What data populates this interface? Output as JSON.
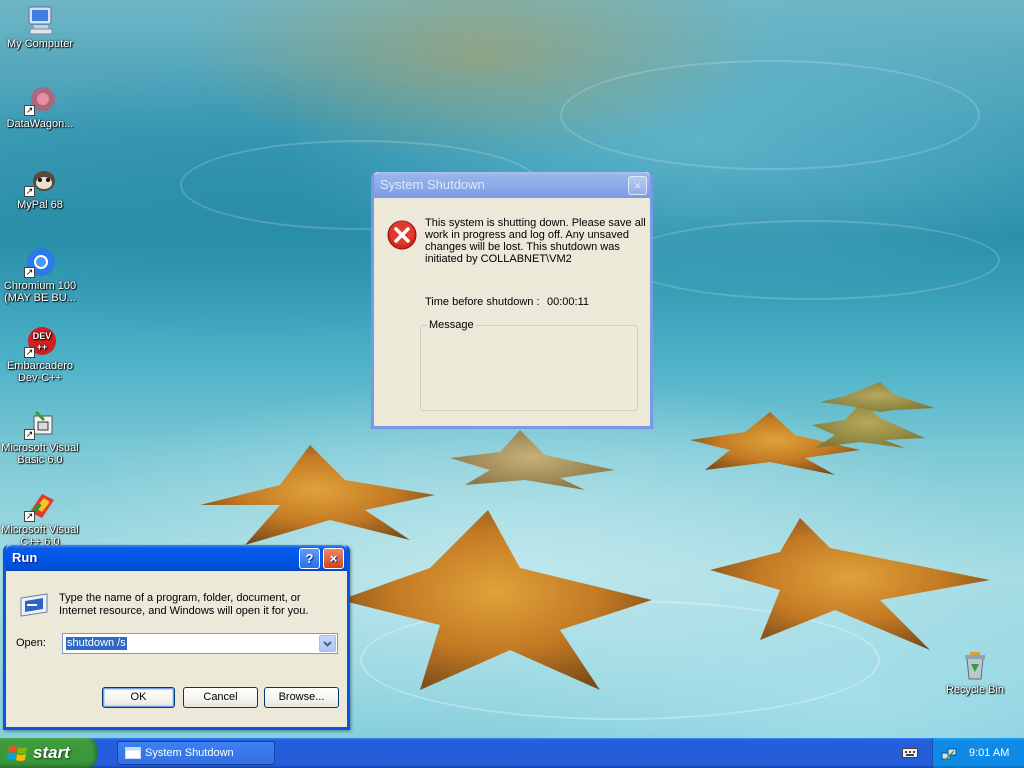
{
  "desktop_icons": [
    {
      "label": "My Computer",
      "icon": "my-computer-icon"
    },
    {
      "label": "DataWagon...",
      "icon": "datawagon-icon"
    },
    {
      "label": "MyPal 68",
      "icon": "mypal-icon"
    },
    {
      "label": "Chromium 100 (MAY BE BU...",
      "icon": "chromium-icon"
    },
    {
      "label": "Embarcadero Dev-C++",
      "icon": "devcpp-icon",
      "badge": "DEV",
      "badge2": "++"
    },
    {
      "label": "Microsoft Visual Basic 6.0",
      "icon": "vb6-icon"
    },
    {
      "label": "Microsoft Visual C++ 6.0",
      "icon": "vc6-icon"
    },
    {
      "label": "Recycle Bin",
      "icon": "recycle-bin-icon"
    }
  ],
  "shutdown_dialog": {
    "title": "System Shutdown",
    "close_glyph": "×",
    "message": "This system is shutting down. Please save all work in progress and log off. Any unsaved changes will be lost. This shutdown was initiated by COLLABNET\\VM2",
    "time_label": "Time before shutdown :",
    "time_value": "00:00:11",
    "message_group_label": "Message",
    "message_text": ""
  },
  "run_dialog": {
    "title": "Run",
    "help_glyph": "?",
    "close_glyph": "×",
    "description": "Type the name of a program, folder, document, or Internet resource, and Windows will open it for you.",
    "open_label": "Open:",
    "open_value": "shutdown /s",
    "ok_label": "OK",
    "cancel_label": "Cancel",
    "browse_label": "Browse..."
  },
  "taskbar": {
    "start_label": "start",
    "tasks": [
      {
        "label": "System Shutdown",
        "active": false
      }
    ],
    "clock": "9:01 AM"
  },
  "colors": {
    "title_active": "#0058e6",
    "title_inactive": "#7b98e2",
    "dialog_face": "#ece9d8",
    "start_green": "#3a953a",
    "tray_blue": "#0f8ae6"
  }
}
